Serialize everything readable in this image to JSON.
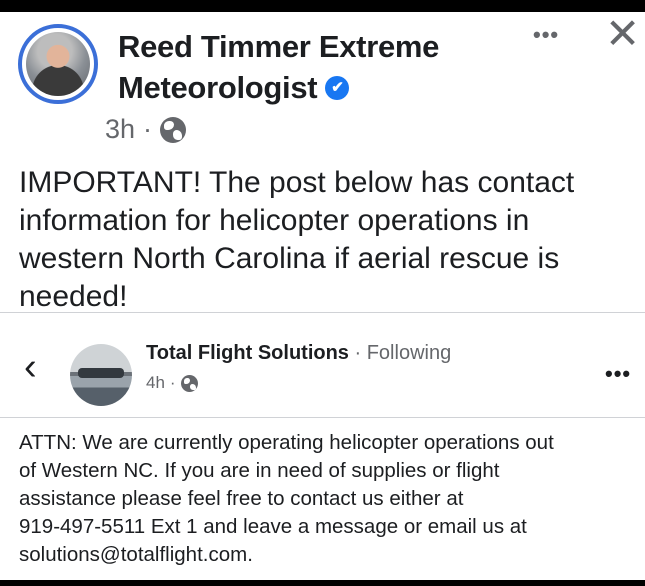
{
  "post": {
    "author_line1": "Reed Timmer Extreme",
    "author_line2": "Meteorologist",
    "verified_icon": "✔",
    "time": "3h",
    "dot": "·",
    "more": "•••",
    "close": "✕",
    "text": "IMPORTANT! The post below has contact information for helicopter operations in western North Carolina if aerial rescue is needed!"
  },
  "shared": {
    "back": "‹",
    "page_name": "Total Flight Solutions",
    "separator": " · ",
    "following": "Following",
    "time": "4h",
    "dot": "·",
    "more": "•••",
    "text": "ATTN: We are currently operating helicopter operations out\nof Western NC.  If you are in need of supplies or flight\nassistance please feel free to contact us either at\n919-497-5511 Ext 1 and leave a message or email us at\nsolutions@totalflight.com."
  },
  "colors": {
    "text": "#1c1e21",
    "secondary": "#65676b",
    "verified": "#1877f2",
    "avatar_ring": "#3b6fd8"
  }
}
